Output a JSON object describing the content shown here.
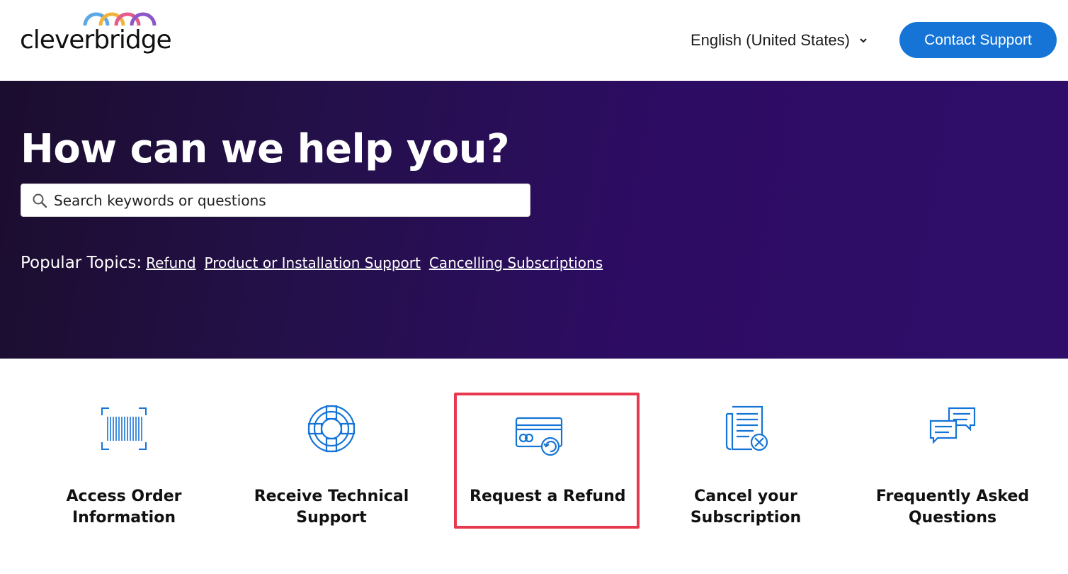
{
  "header": {
    "logo_text": "cleverbridge",
    "language": "English (United States)",
    "contact_label": "Contact Support"
  },
  "hero": {
    "title": "How can we help you?",
    "search_placeholder": "Search keywords or questions",
    "popular_label": "Popular Topics:",
    "topics": [
      "Refund",
      "Product or Installation Support",
      "Cancelling Subscriptions"
    ]
  },
  "cards": [
    {
      "title": "Access Order Information",
      "icon": "barcode-icon"
    },
    {
      "title": "Receive Technical Support",
      "icon": "lifebuoy-icon"
    },
    {
      "title": "Request a Refund",
      "icon": "credit-card-refund-icon"
    },
    {
      "title": "Cancel your Subscription",
      "icon": "document-cancel-icon"
    },
    {
      "title": "Frequently Asked Questions",
      "icon": "chat-bubbles-icon"
    }
  ],
  "colors": {
    "accent": "#1574d6",
    "hero_bg": "#2d0c63",
    "highlight": "#e8384f",
    "icon": "#1574d6"
  }
}
